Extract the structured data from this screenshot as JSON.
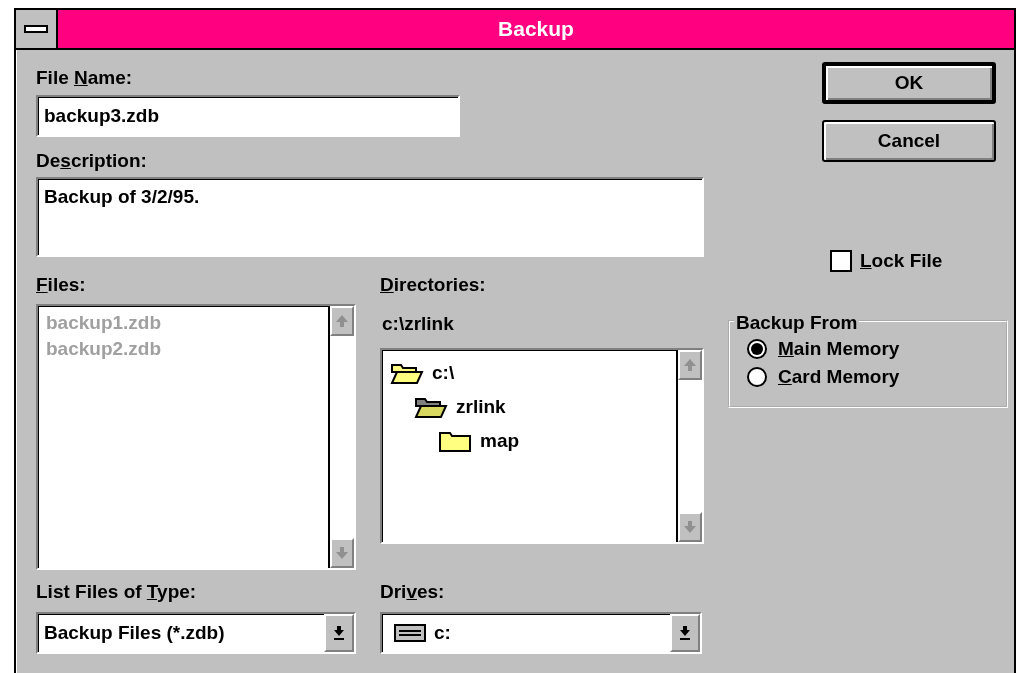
{
  "window": {
    "title": "Backup"
  },
  "file_name": {
    "label": {
      "before": "File ",
      "key": "N",
      "after": "ame:"
    },
    "value": "backup3.zdb"
  },
  "description": {
    "label": {
      "before": "De",
      "key": "s",
      "after": "cription:"
    },
    "value": "Backup of 3/2/95."
  },
  "files": {
    "label": {
      "key": "F",
      "after": "iles:"
    },
    "disabled": true,
    "items": [
      "backup1.zdb",
      "backup2.zdb"
    ]
  },
  "directories": {
    "label": {
      "key": "D",
      "after": "irectories:"
    },
    "path": "c:\\zrlink",
    "items": [
      {
        "name": "c:\\",
        "kind": "open",
        "children": [
          {
            "name": "zrlink",
            "kind": "current",
            "children": [
              {
                "name": "map",
                "kind": "closed"
              }
            ]
          }
        ]
      }
    ]
  },
  "file_type": {
    "label": {
      "before": "List Files of ",
      "key": "T",
      "after": "ype:"
    },
    "value": "Backup Files (*.zdb)"
  },
  "drives": {
    "label": {
      "before": "Dri",
      "key": "v",
      "after": "es:"
    },
    "value": "c:"
  },
  "buttons": [
    {
      "label": "OK",
      "default": true
    },
    {
      "label": "Cancel",
      "default": false
    }
  ],
  "lock_file": {
    "label": {
      "key": "L",
      "after": "ock File"
    },
    "checked": false
  },
  "backup_from": {
    "title": "Backup From",
    "options": [
      {
        "label": {
          "key": "M",
          "after": "ain Memory"
        },
        "selected": true
      },
      {
        "label": {
          "key": "C",
          "after": "ard Memory"
        },
        "selected": false
      }
    ]
  }
}
